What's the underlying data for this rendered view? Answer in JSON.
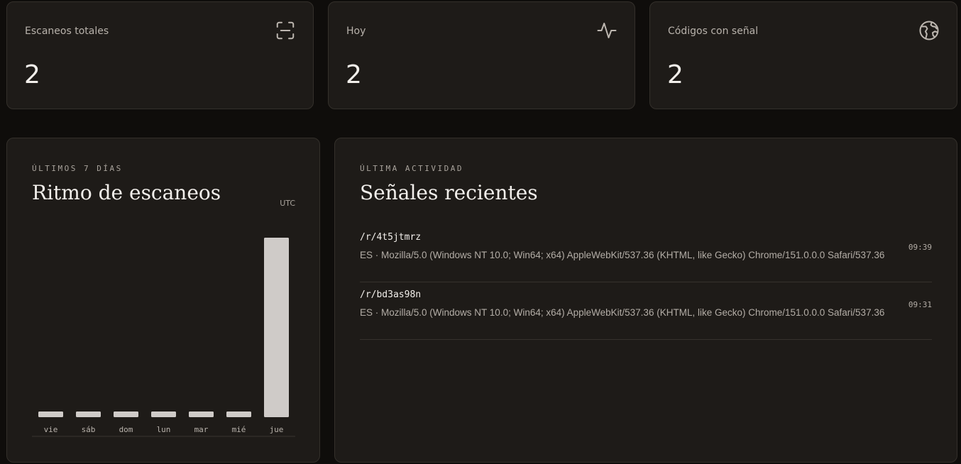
{
  "stats": [
    {
      "label": "Escaneos totales",
      "value": "2",
      "icon": "scan-icon"
    },
    {
      "label": "Hoy",
      "value": "2",
      "icon": "activity-icon"
    },
    {
      "label": "Códigos con señal",
      "value": "2",
      "icon": "globe-icon"
    }
  ],
  "chart_panel": {
    "eyebrow": "ÚLTIMOS 7 DÍAS",
    "title": "Ritmo de escaneos",
    "timezone": "UTC"
  },
  "chart_data": {
    "type": "bar",
    "categories": [
      "vie",
      "sáb",
      "dom",
      "lun",
      "mar",
      "mié",
      "jue"
    ],
    "values": [
      0,
      0,
      0,
      0,
      0,
      0,
      2
    ],
    "ylim": [
      0,
      2
    ],
    "grid": false,
    "bar_color": "#cfcbc8"
  },
  "activity_panel": {
    "eyebrow": "ÚLTIMA ACTIVIDAD",
    "title": "Señales recientes",
    "items": [
      {
        "path": "/r/4t5jtmrz",
        "meta": "ES · Mozilla/5.0 (Windows NT 10.0; Win64; x64) AppleWebKit/537.36 (KHTML, like Gecko) Chrome/151.0.0.0 Safari/537.36",
        "time": "09:39"
      },
      {
        "path": "/r/bd3as98n",
        "meta": "ES · Mozilla/5.0 (Windows NT 10.0; Win64; x64) AppleWebKit/537.36 (KHTML, like Gecko) Chrome/151.0.0.0 Safari/537.36",
        "time": "09:31"
      }
    ]
  },
  "colors": {
    "background": "#0f0d0b",
    "card": "#1e1b18",
    "border": "#34302b",
    "text": "#f2efeb",
    "muted": "#b3ada6"
  }
}
